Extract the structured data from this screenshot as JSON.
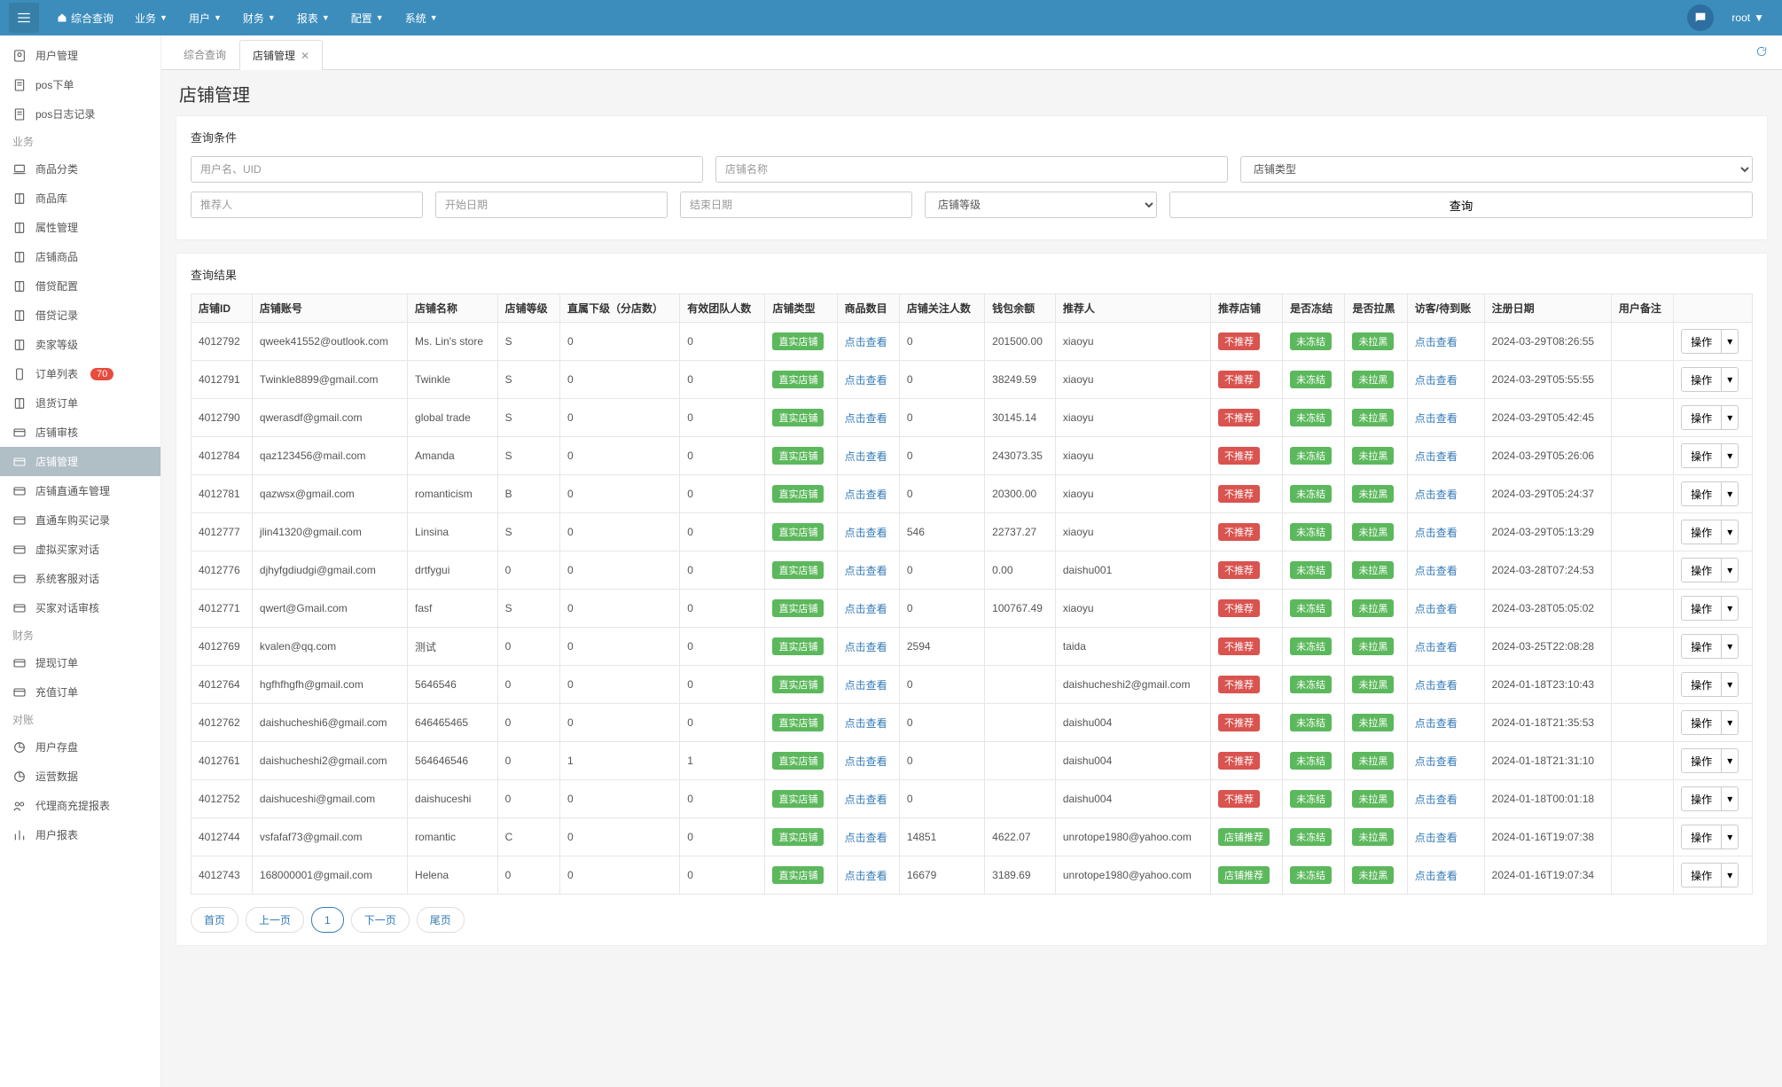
{
  "topnav": {
    "home": "综合查询",
    "items": [
      "业务",
      "用户",
      "财务",
      "报表",
      "配置",
      "系统"
    ],
    "username": "root"
  },
  "sidebar": {
    "groups": [
      {
        "heading": null,
        "items": [
          {
            "icon": "user",
            "label": "用户管理"
          },
          {
            "icon": "doc",
            "label": "pos下单"
          },
          {
            "icon": "doc",
            "label": "pos日志记录"
          }
        ]
      },
      {
        "heading": "业务",
        "items": [
          {
            "icon": "laptop",
            "label": "商品分类"
          },
          {
            "icon": "book",
            "label": "商品库"
          },
          {
            "icon": "book",
            "label": "属性管理"
          },
          {
            "icon": "book",
            "label": "店铺商品"
          },
          {
            "icon": "book",
            "label": "借贷配置"
          },
          {
            "icon": "book",
            "label": "借贷记录"
          },
          {
            "icon": "book",
            "label": "卖家等级"
          },
          {
            "icon": "phone",
            "label": "订单列表",
            "badge": "70"
          },
          {
            "icon": "book",
            "label": "退货订单"
          },
          {
            "icon": "card",
            "label": "店铺审核"
          },
          {
            "icon": "card",
            "label": "店铺管理",
            "active": true
          },
          {
            "icon": "card",
            "label": "店铺直通车管理"
          },
          {
            "icon": "card",
            "label": "直通车购买记录"
          },
          {
            "icon": "card",
            "label": "虚拟买家对话"
          },
          {
            "icon": "card",
            "label": "系统客服对话"
          },
          {
            "icon": "card",
            "label": "买家对话审核"
          }
        ]
      },
      {
        "heading": "财务",
        "items": [
          {
            "icon": "card",
            "label": "提现订单"
          },
          {
            "icon": "card",
            "label": "充值订单"
          }
        ]
      },
      {
        "heading": "对账",
        "items": [
          {
            "icon": "pie",
            "label": "用户存盘"
          },
          {
            "icon": "pie",
            "label": "运营数据"
          },
          {
            "icon": "people",
            "label": "代理商充提报表"
          },
          {
            "icon": "bars",
            "label": "用户报表"
          }
        ]
      }
    ]
  },
  "tabs": {
    "items": [
      {
        "label": "综合查询",
        "active": false,
        "closable": false
      },
      {
        "label": "店铺管理",
        "active": true,
        "closable": true
      }
    ]
  },
  "page": {
    "title": "店铺管理"
  },
  "filters": {
    "title": "查询条件",
    "placeholders": {
      "user": "用户名、UID",
      "shop": "店铺名称",
      "type": "店铺类型",
      "referrer": "推荐人",
      "start": "开始日期",
      "end": "结束日期",
      "level": "店铺等级"
    },
    "query_btn": "查询"
  },
  "results": {
    "title": "查询结果",
    "columns": [
      "店铺ID",
      "店铺账号",
      "店铺名称",
      "店铺等级",
      "直属下级（分店数）",
      "有效团队人数",
      "店铺类型",
      "商品数目",
      "店铺关注人数",
      "钱包余额",
      "推荐人",
      "推荐店铺",
      "是否冻结",
      "是否拉黑",
      "访客/待到账",
      "注册日期",
      "用户备注",
      ""
    ],
    "type_badge": "直实店铺",
    "click_view": "点击查看",
    "rec_no": "不推荐",
    "rec_yes": "店铺推荐",
    "frozen_no": "未冻结",
    "black_no": "未拉黑",
    "action_label": "操作",
    "rows": [
      {
        "id": "4012792",
        "acct": "qweek41552@outlook.com",
        "name": "Ms. Lin's store",
        "lvl": "S",
        "sub": "0",
        "team": "0",
        "goods": "点击查看",
        "follow": "0",
        "bal": "201500.00",
        "ref": "xiaoyu",
        "rec": "no",
        "date": "2024-03-29T08:26:55"
      },
      {
        "id": "4012791",
        "acct": "Twinkle8899@gmail.com",
        "name": "Twinkle",
        "lvl": "S",
        "sub": "0",
        "team": "0",
        "goods": "点击查看",
        "follow": "0",
        "bal": "38249.59",
        "ref": "xiaoyu",
        "rec": "no",
        "date": "2024-03-29T05:55:55"
      },
      {
        "id": "4012790",
        "acct": "qwerasdf@gmail.com",
        "name": "global trade",
        "lvl": "S",
        "sub": "0",
        "team": "0",
        "goods": "点击查看",
        "follow": "0",
        "bal": "30145.14",
        "ref": "xiaoyu",
        "rec": "no",
        "date": "2024-03-29T05:42:45"
      },
      {
        "id": "4012784",
        "acct": "qaz123456@mail.com",
        "name": "Amanda",
        "lvl": "S",
        "sub": "0",
        "team": "0",
        "goods": "点击查看",
        "follow": "0",
        "bal": "243073.35",
        "ref": "xiaoyu",
        "rec": "no",
        "date": "2024-03-29T05:26:06"
      },
      {
        "id": "4012781",
        "acct": "qazwsx@gmail.com",
        "name": "romanticism",
        "lvl": "B",
        "sub": "0",
        "team": "0",
        "goods": "点击查看",
        "follow": "0",
        "bal": "20300.00",
        "ref": "xiaoyu",
        "rec": "no",
        "date": "2024-03-29T05:24:37"
      },
      {
        "id": "4012777",
        "acct": "jlin41320@gmail.com",
        "name": "Linsina",
        "lvl": "S",
        "sub": "0",
        "team": "0",
        "goods": "点击查看",
        "follow": "546",
        "bal": "22737.27",
        "ref": "xiaoyu",
        "rec": "no",
        "date": "2024-03-29T05:13:29"
      },
      {
        "id": "4012776",
        "acct": "djhyfgdiudgi@gmail.com",
        "name": "drtfygui",
        "lvl": "0",
        "sub": "0",
        "team": "0",
        "goods": "点击查看",
        "follow": "0",
        "bal": "0.00",
        "ref": "daishu001",
        "rec": "no",
        "date": "2024-03-28T07:24:53"
      },
      {
        "id": "4012771",
        "acct": "qwert@Gmail.com",
        "name": "fasf",
        "lvl": "S",
        "sub": "0",
        "team": "0",
        "goods": "点击查看",
        "follow": "0",
        "bal": "100767.49",
        "ref": "xiaoyu",
        "rec": "no",
        "date": "2024-03-28T05:05:02"
      },
      {
        "id": "4012769",
        "acct": "kvalen@qq.com",
        "name": "测试",
        "lvl": "0",
        "sub": "0",
        "team": "0",
        "goods": "点击查看",
        "follow": "2594",
        "bal": "",
        "ref": "taida",
        "rec": "no",
        "date": "2024-03-25T22:08:28"
      },
      {
        "id": "4012764",
        "acct": "hgfhfhgfh@gmail.com",
        "name": "5646546",
        "lvl": "0",
        "sub": "0",
        "team": "0",
        "goods": "点击查看",
        "follow": "0",
        "bal": "",
        "ref": "daishucheshi2@gmail.com",
        "rec": "no",
        "date": "2024-01-18T23:10:43"
      },
      {
        "id": "4012762",
        "acct": "daishucheshi6@gmail.com",
        "name": "646465465",
        "lvl": "0",
        "sub": "0",
        "team": "0",
        "goods": "点击查看",
        "follow": "0",
        "bal": "",
        "ref": "daishu004",
        "rec": "no",
        "date": "2024-01-18T21:35:53"
      },
      {
        "id": "4012761",
        "acct": "daishucheshi2@gmail.com",
        "name": "564646546",
        "lvl": "0",
        "sub": "1",
        "team": "1",
        "goods": "点击查看",
        "follow": "0",
        "bal": "",
        "ref": "daishu004",
        "rec": "no",
        "date": "2024-01-18T21:31:10"
      },
      {
        "id": "4012752",
        "acct": "daishuceshi@gmail.com",
        "name": "daishuceshi",
        "lvl": "0",
        "sub": "0",
        "team": "0",
        "goods": "点击查看",
        "follow": "0",
        "bal": "",
        "ref": "daishu004",
        "rec": "no",
        "date": "2024-01-18T00:01:18"
      },
      {
        "id": "4012744",
        "acct": "vsfafaf73@gmail.com",
        "name": "romantic",
        "lvl": "C",
        "sub": "0",
        "team": "0",
        "goods": "点击查看",
        "follow": "14851",
        "bal": "4622.07",
        "ref": "unrotope1980@yahoo.com",
        "rec": "yes",
        "date": "2024-01-16T19:07:38"
      },
      {
        "id": "4012743",
        "acct": "168000001@gmail.com",
        "name": "Helena",
        "lvl": "0",
        "sub": "0",
        "team": "0",
        "goods": "点击查看",
        "follow": "16679",
        "bal": "3189.69",
        "ref": "unrotope1980@yahoo.com",
        "rec": "yes",
        "date": "2024-01-16T19:07:34"
      }
    ]
  },
  "pagination": {
    "first": "首页",
    "prev": "上一页",
    "current": "1",
    "next": "下一页",
    "last": "尾页"
  }
}
